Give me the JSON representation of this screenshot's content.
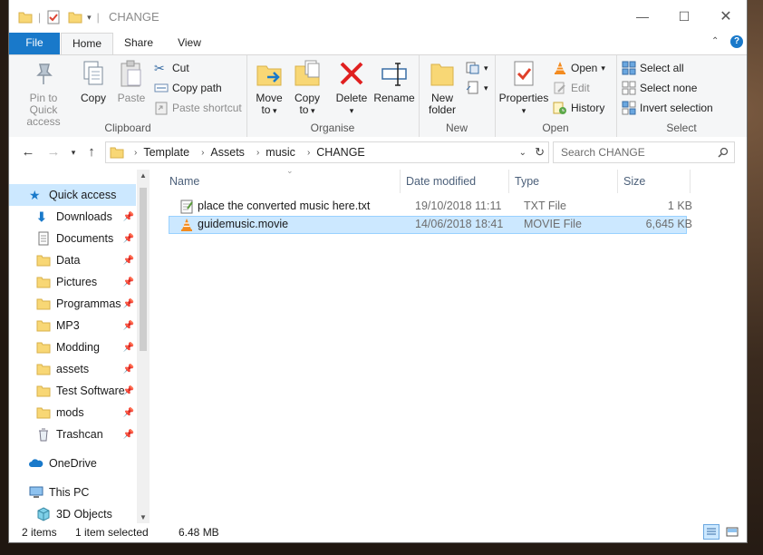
{
  "window": {
    "title": "CHANGE"
  },
  "tabs": [
    {
      "label": "File"
    },
    {
      "label": "Home"
    },
    {
      "label": "Share"
    },
    {
      "label": "View"
    }
  ],
  "ribbon": {
    "clipboard": {
      "pin_label1": "Pin to Quick",
      "pin_label2": "access",
      "copy": "Copy",
      "paste": "Paste",
      "cut": "Cut",
      "copy_path": "Copy path",
      "paste_shortcut": "Paste shortcut",
      "group": "Clipboard"
    },
    "organise": {
      "move1": "Move",
      "move2": "to",
      "copy1": "Copy",
      "copy2": "to",
      "delete": "Delete",
      "rename": "Rename",
      "group": "Organise"
    },
    "new": {
      "nf1": "New",
      "nf2": "folder",
      "group": "New"
    },
    "open": {
      "properties": "Properties",
      "open": "Open",
      "edit": "Edit",
      "history": "History",
      "group": "Open"
    },
    "select": {
      "all": "Select all",
      "none": "Select none",
      "invert": "Invert selection",
      "group": "Select"
    }
  },
  "address": {
    "crumbs": [
      "Template",
      "Assets",
      "music",
      "CHANGE"
    ],
    "search_placeholder": "Search CHANGE"
  },
  "nav": {
    "quick_access": "Quick access",
    "items": [
      {
        "label": "Downloads"
      },
      {
        "label": "Documents"
      },
      {
        "label": "Data"
      },
      {
        "label": "Pictures"
      },
      {
        "label": "Programmas"
      },
      {
        "label": "MP3"
      },
      {
        "label": "Modding"
      },
      {
        "label": "assets"
      },
      {
        "label": "Test Software"
      },
      {
        "label": "mods"
      },
      {
        "label": "Trashcan"
      }
    ],
    "onedrive": "OneDrive",
    "thispc": "This PC",
    "objects3d": "3D Objects"
  },
  "columns": {
    "name": "Name",
    "date": "Date modified",
    "type": "Type",
    "size": "Size"
  },
  "files": [
    {
      "name": "place the converted music here.txt",
      "date": "19/10/2018 11:11",
      "type": "TXT File",
      "size": "1 KB"
    },
    {
      "name": "guidemusic.movie",
      "date": "14/06/2018 18:41",
      "type": "MOVIE File",
      "size": "6,645 KB"
    }
  ],
  "status": {
    "items": "2 items",
    "selected": "1 item selected",
    "size": "6.48 MB"
  },
  "colors": {
    "accent": "#1979ca",
    "selection": "#cce8ff",
    "folder": "#f8d775"
  }
}
